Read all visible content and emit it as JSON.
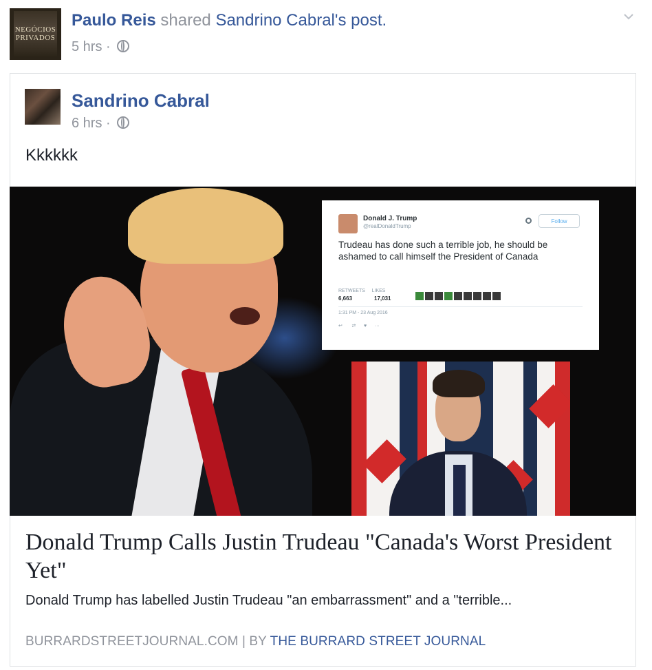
{
  "share_header": {
    "sharer_name": "Paulo Reis",
    "shared_text": " shared ",
    "original_author": "Sandrino Cabral",
    "post_suffix": "'s post.",
    "timestamp": "5 hrs",
    "separator": " · ",
    "avatar_text_line1": "NEGÓCIOS",
    "avatar_text_line2": "PRIVADOS"
  },
  "original_post": {
    "author_name": "Sandrino Cabral",
    "timestamp": "6 hrs",
    "separator": " · ",
    "message": "Kkkkkk"
  },
  "tweet_image": {
    "name": "Donald J. Trump",
    "handle": "@realDonaldTrump",
    "follow_label": "Follow",
    "text": "Trudeau has done such a terrible job, he should be ashamed to call himself the President of Canada",
    "retweets_label": "RETWEETS",
    "retweets": "6,663",
    "likes_label": "LIKES",
    "likes": "17,031",
    "date": "1:31 PM - 23 Aug 2016"
  },
  "link_preview": {
    "headline": "Donald Trump Calls Justin Trudeau \"Canada's Worst President Yet\"",
    "description": "Donald Trump has labelled Justin Trudeau \"an embarrassment\" and a \"terrible...",
    "domain": "BURRARDSTREETJOURNAL.COM",
    "divider": " | ",
    "by_prefix": "BY ",
    "byline": "THE BURRARD STREET JOURNAL"
  }
}
